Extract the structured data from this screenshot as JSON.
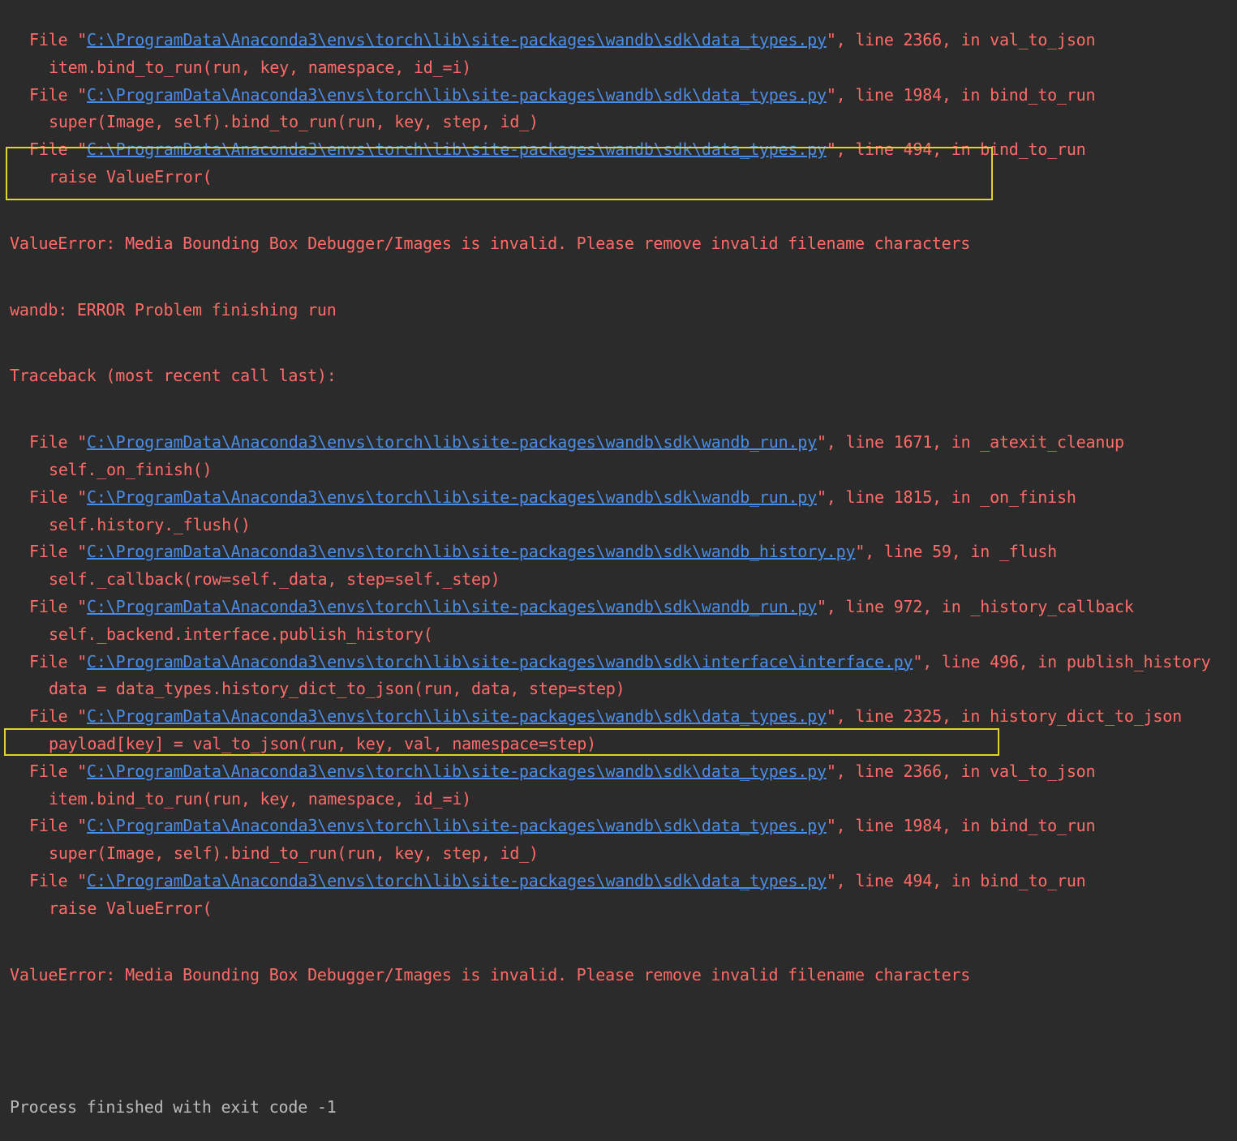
{
  "trace_top": [
    {
      "kind": "file",
      "prefix": "File \"",
      "path": "C:\\ProgramData\\Anaconda3\\envs\\torch\\lib\\site-packages\\wandb\\sdk\\data_types.py",
      "suffix": "\", line 2366, in val_to_json"
    },
    {
      "kind": "code",
      "text": "item.bind_to_run(run, key, namespace, id_=i)"
    },
    {
      "kind": "file",
      "prefix": "File \"",
      "path": "C:\\ProgramData\\Anaconda3\\envs\\torch\\lib\\site-packages\\wandb\\sdk\\data_types.py",
      "suffix": "\", line 1984, in bind_to_run"
    },
    {
      "kind": "code",
      "text": "super(Image, self).bind_to_run(run, key, step, id_)"
    },
    {
      "kind": "file",
      "prefix": "File \"",
      "path": "C:\\ProgramData\\Anaconda3\\envs\\torch\\lib\\site-packages\\wandb\\sdk\\data_types.py",
      "suffix": "\", line 494, in bind_to_run"
    },
    {
      "kind": "code",
      "text": "raise ValueError("
    }
  ],
  "error_1": "ValueError: Media Bounding Box Debugger/Images is invalid. Please remove invalid filename characters",
  "wandb_error": "wandb: ERROR Problem finishing run",
  "traceback_header": "Traceback (most recent call last):",
  "trace_main": [
    {
      "kind": "file",
      "prefix": "File \"",
      "path": "C:\\ProgramData\\Anaconda3\\envs\\torch\\lib\\site-packages\\wandb\\sdk\\wandb_run.py",
      "suffix": "\", line 1671, in _atexit_cleanup"
    },
    {
      "kind": "code",
      "text": "self._on_finish()"
    },
    {
      "kind": "file",
      "prefix": "File \"",
      "path": "C:\\ProgramData\\Anaconda3\\envs\\torch\\lib\\site-packages\\wandb\\sdk\\wandb_run.py",
      "suffix": "\", line 1815, in _on_finish"
    },
    {
      "kind": "code",
      "text": "self.history._flush()"
    },
    {
      "kind": "file",
      "prefix": "File \"",
      "path": "C:\\ProgramData\\Anaconda3\\envs\\torch\\lib\\site-packages\\wandb\\sdk\\wandb_history.py",
      "suffix": "\", line 59, in _flush"
    },
    {
      "kind": "code",
      "text": "self._callback(row=self._data, step=self._step)"
    },
    {
      "kind": "file",
      "prefix": "File \"",
      "path": "C:\\ProgramData\\Anaconda3\\envs\\torch\\lib\\site-packages\\wandb\\sdk\\wandb_run.py",
      "suffix": "\", line 972, in _history_callback"
    },
    {
      "kind": "code",
      "text": "self._backend.interface.publish_history("
    },
    {
      "kind": "file",
      "prefix": "File \"",
      "path": "C:\\ProgramData\\Anaconda3\\envs\\torch\\lib\\site-packages\\wandb\\sdk\\interface\\interface.py",
      "suffix": "\", line 496, in publish_history"
    },
    {
      "kind": "code",
      "text": "data = data_types.history_dict_to_json(run, data, step=step)"
    },
    {
      "kind": "file",
      "prefix": "File \"",
      "path": "C:\\ProgramData\\Anaconda3\\envs\\torch\\lib\\site-packages\\wandb\\sdk\\data_types.py",
      "suffix": "\", line 2325, in history_dict_to_json"
    },
    {
      "kind": "code",
      "text": "payload[key] = val_to_json(run, key, val, namespace=step)"
    },
    {
      "kind": "file",
      "prefix": "File \"",
      "path": "C:\\ProgramData\\Anaconda3\\envs\\torch\\lib\\site-packages\\wandb\\sdk\\data_types.py",
      "suffix": "\", line 2366, in val_to_json"
    },
    {
      "kind": "code",
      "text": "item.bind_to_run(run, key, namespace, id_=i)"
    },
    {
      "kind": "file",
      "prefix": "File \"",
      "path": "C:\\ProgramData\\Anaconda3\\envs\\torch\\lib\\site-packages\\wandb\\sdk\\data_types.py",
      "suffix": "\", line 1984, in bind_to_run"
    },
    {
      "kind": "code",
      "text": "super(Image, self).bind_to_run(run, key, step, id_)"
    },
    {
      "kind": "file",
      "prefix": "File \"",
      "path": "C:\\ProgramData\\Anaconda3\\envs\\torch\\lib\\site-packages\\wandb\\sdk\\data_types.py",
      "suffix": "\", line 494, in bind_to_run"
    },
    {
      "kind": "code",
      "text": "raise ValueError("
    }
  ],
  "error_2": "ValueError: Media Bounding Box Debugger/Images is invalid. Please remove invalid filename characters",
  "exit_message": "Process finished with exit code -1",
  "colors": {
    "background": "#2b2b2b",
    "error_text": "#ff6b68",
    "link": "#4a8de6",
    "normal_text": "#bbbbbb",
    "highlight_box": "#e0d32c"
  }
}
